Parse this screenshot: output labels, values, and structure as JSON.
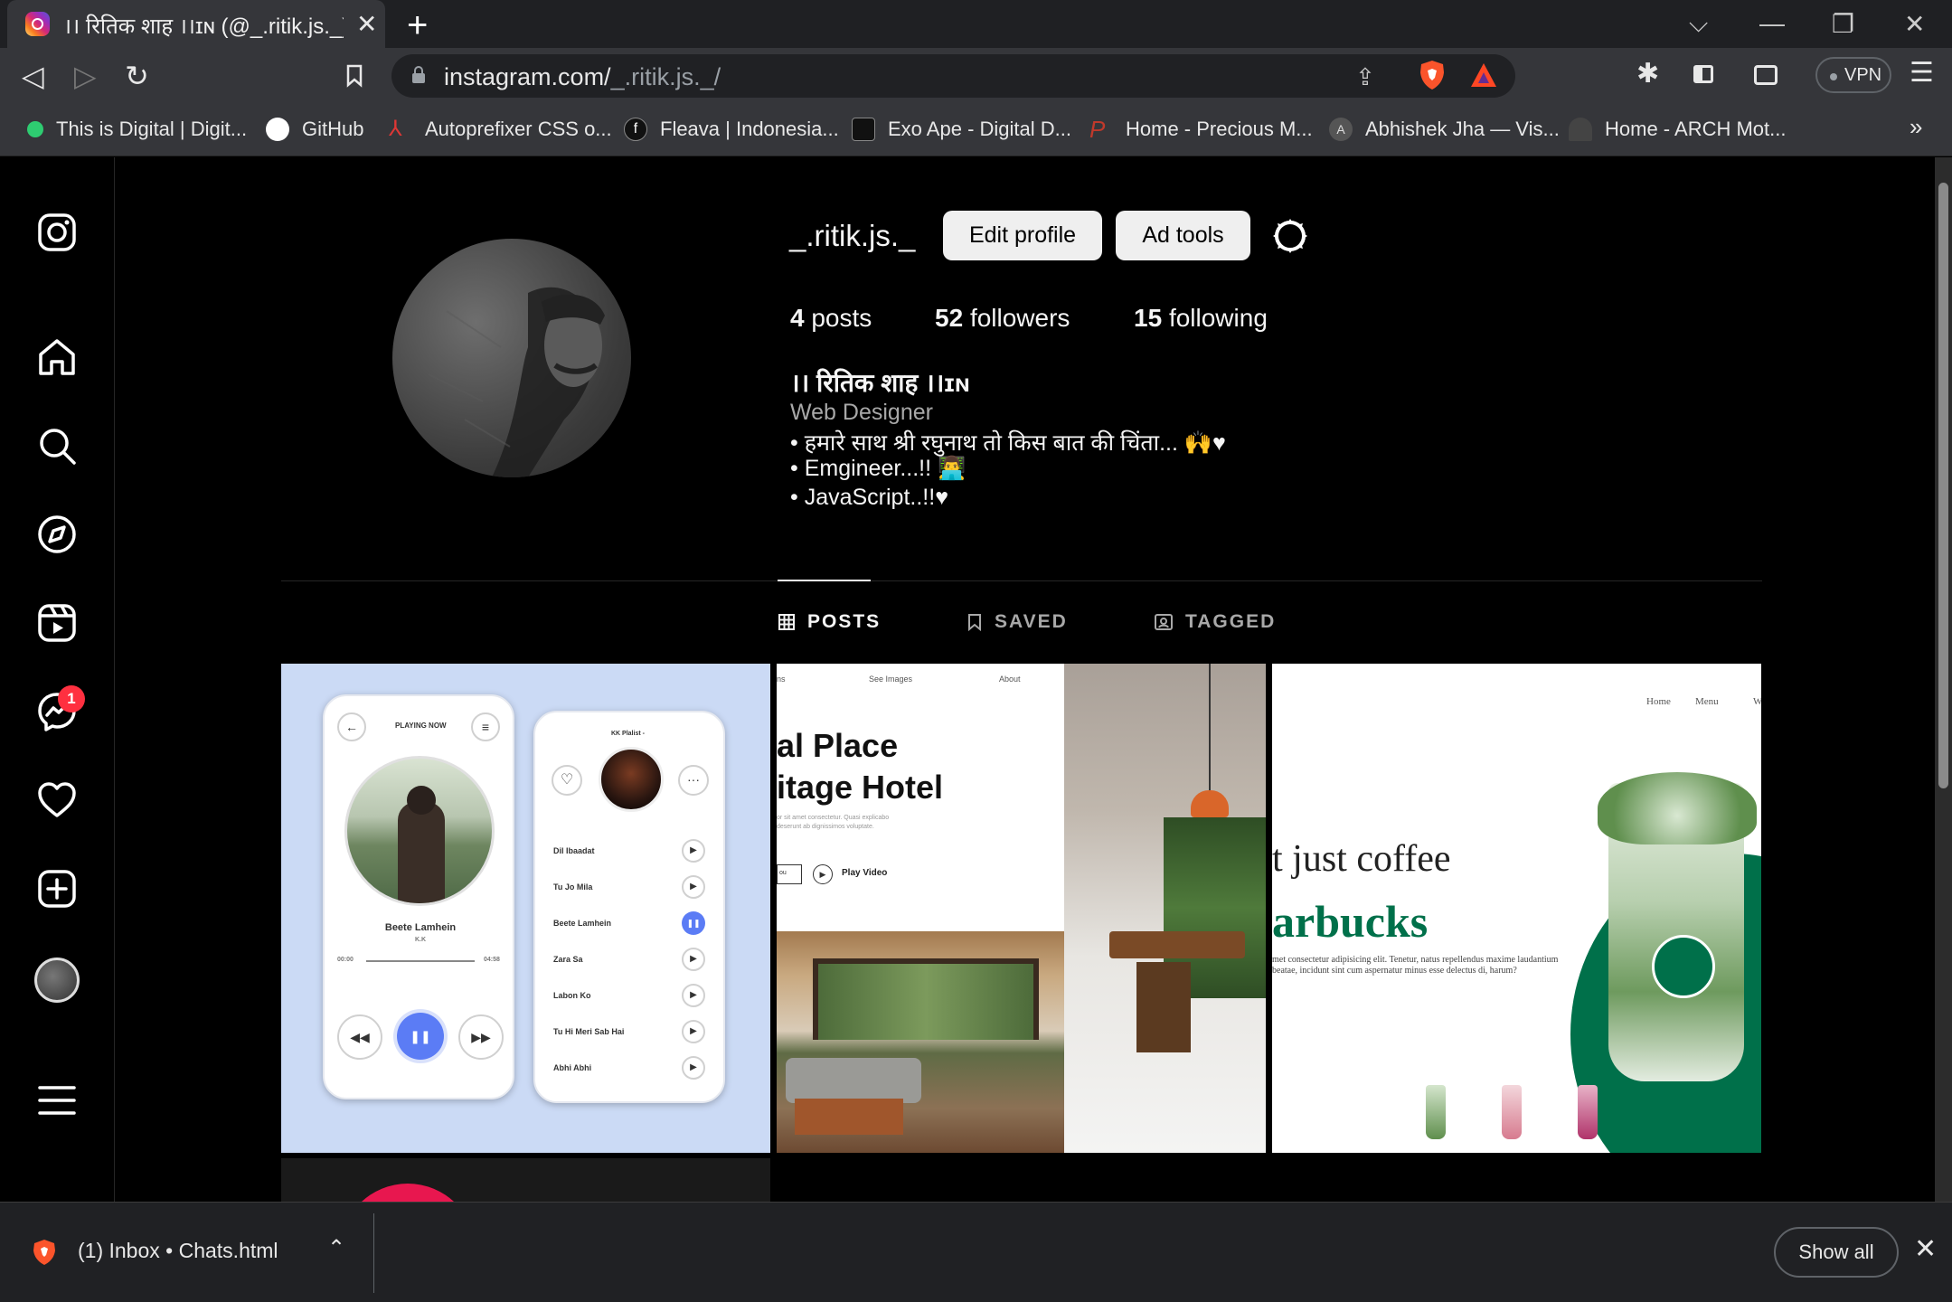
{
  "browser": {
    "tab_title": "।। रितिक शाह ।।ɪɴ (@_.ritik.js._) • Instagram",
    "tab_close": "✕",
    "new_tab": "+",
    "window_controls": [
      "⌵",
      "—",
      "❐",
      "✕"
    ],
    "nav": {
      "back": "◁",
      "forward": "▷",
      "reload": "↻",
      "bookmark": "🔖"
    },
    "url_host": "instagram.com/",
    "url_path": "_.ritik.js._/",
    "vpn_label": "VPN",
    "menu": "☰",
    "bookmarks_more": "»",
    "bookmarks": [
      {
        "label": "This is Digital | Digit...",
        "icon": "green-dot-icon",
        "color": "#2ecc71"
      },
      {
        "label": "GitHub",
        "icon": "github-icon",
        "color": "#ffffff"
      },
      {
        "label": "Autoprefixer CSS o...",
        "icon": "autoprefixer-icon",
        "color": "#dd3735"
      },
      {
        "label": "Fleava | Indonesia...",
        "icon": "fleava-icon",
        "color": "#111111"
      },
      {
        "label": "Exo Ape - Digital D...",
        "icon": "exoape-icon",
        "color": "#111111"
      },
      {
        "label": "Home - Precious M...",
        "icon": "precious-icon",
        "color": "#c0392b"
      },
      {
        "label": "Abhishek Jha — Vis...",
        "icon": "abhishek-icon",
        "color": "#555555"
      },
      {
        "label": "Home - ARCH Mot...",
        "icon": "arch-icon",
        "color": "#444444"
      }
    ]
  },
  "profile": {
    "username": "_.ritik.js._",
    "edit_profile": "Edit profile",
    "ad_tools": "Ad tools",
    "stats": [
      {
        "count": "4",
        "label": "posts"
      },
      {
        "count": "52",
        "label": "followers"
      },
      {
        "count": "15",
        "label": "following"
      }
    ],
    "full_name": "।। रितिक शाह ।।ɪɴ",
    "category": "Web Designer",
    "bio": [
      "• हमारे साथ श्री रघुनाथ तो किस बात की चिंता... 🙌♥",
      "• Emgineer...!! 👨‍💻",
      "• JavaScript..!!♥"
    ],
    "tabs": [
      {
        "label": "POSTS",
        "icon": "grid-icon",
        "active": true
      },
      {
        "label": "SAVED",
        "icon": "bookmark-icon",
        "active": false
      },
      {
        "label": "TAGGED",
        "icon": "tag-icon",
        "active": false
      }
    ]
  },
  "sidebar": {
    "notification_count": "1",
    "items": [
      "instagram-logo-icon",
      "home-icon",
      "search-icon",
      "explore-icon",
      "reels-icon",
      "messenger-icon",
      "heart-icon",
      "create-icon",
      "profile-avatar",
      "more-menu-icon"
    ]
  },
  "posts": {
    "post1": {
      "left_header": "PLAYING NOW",
      "right_header": "KK Plalist -",
      "song_title": "Beete Lamhein",
      "artist": "K.K",
      "time_start": "00:00",
      "time_end": "04:58",
      "playlist": [
        "Dil Ibaadat",
        "Tu Jo Mila",
        "Beete Lamhein",
        "Zara Sa",
        "Labon Ko",
        "Tu Hi Meri Sab Hai",
        "Abhi Abhi"
      ]
    },
    "post2": {
      "nav_1": "See Images",
      "nav_2": "About",
      "nav_0": "ns",
      "headline_1": "al Place",
      "headline_2": "itage Hotel",
      "body": "or sit amet consectetur. Quasi explicabo deserunt ab dignissimos voluptate.",
      "btn_left": "ou",
      "play_video": "Play Video"
    },
    "post3": {
      "nav_home": "Home",
      "nav_menu": "Menu",
      "nav_w": "W",
      "headline_1": "t just coffee",
      "headline_2": "arbucks",
      "body": "met consectetur adipisicing elit. Tenetur, natus repellendus maxime laudantium beatae, incidunt sint cum aspernatur minus esse delectus di, harum?"
    }
  },
  "downloads": {
    "file_name": "(1) Inbox • Chats.html",
    "chevron": "⌃",
    "show_all": "Show all",
    "close": "✕"
  },
  "colors": {
    "accent_button": "#efefef",
    "notification": "#ff3040",
    "starbucks_green": "#00704a",
    "player_blue": "#5b7cf5"
  }
}
